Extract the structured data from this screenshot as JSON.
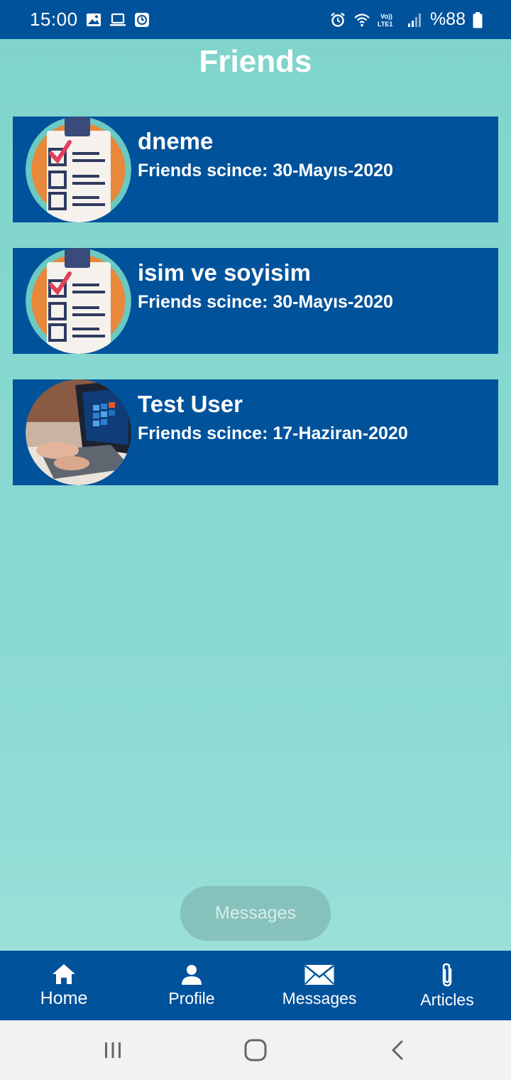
{
  "status_bar": {
    "time": "15:00",
    "battery": "%88",
    "left_icons": [
      "image-icon",
      "laptop-icon",
      "clock-app-icon"
    ],
    "right_icons": [
      "alarm-icon",
      "wifi-icon",
      "volte-lte-icon",
      "signal-icon",
      "battery-icon"
    ],
    "volte_label": "Vo)) LTE1"
  },
  "header": {
    "title": "Friends"
  },
  "friends": [
    {
      "name": "dneme",
      "since": "Friends scince: 30-Mayıs-2020",
      "avatar": "checklist-avatar-icon"
    },
    {
      "name": "isim ve soyisim",
      "since": "Friends scince: 30-Mayıs-2020",
      "avatar": "checklist-avatar-icon"
    },
    {
      "name": "Test User",
      "since": "Friends scince: 17-Haziran-2020",
      "avatar": "laptop-photo-avatar"
    }
  ],
  "floating_button": {
    "label": "Messages"
  },
  "bottom_nav": {
    "items": [
      {
        "label": "Home",
        "icon": "home-icon"
      },
      {
        "label": "Profile",
        "icon": "person-icon"
      },
      {
        "label": "Messages",
        "icon": "envelope-icon"
      },
      {
        "label": "Articles",
        "icon": "paperclip-icon"
      }
    ]
  },
  "colors": {
    "primary": "#00529b",
    "background": "#86d8d0",
    "accent": "#e8883a"
  }
}
